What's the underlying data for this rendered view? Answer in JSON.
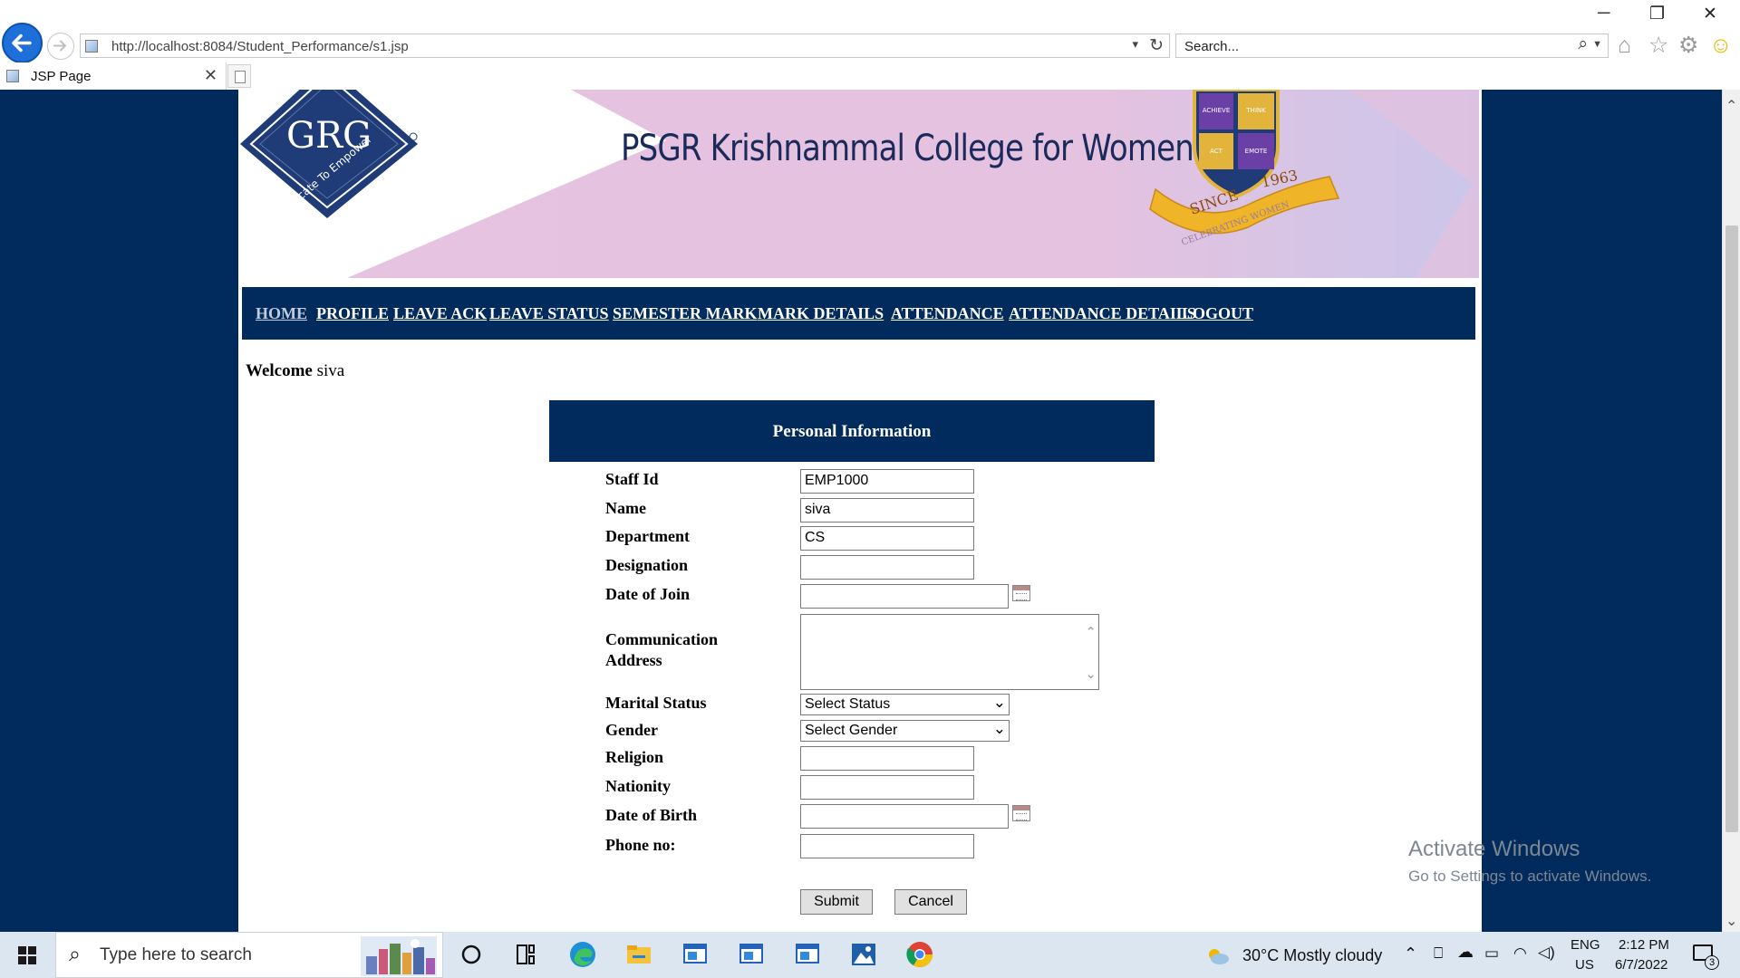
{
  "browser": {
    "url": "http://localhost:8084/Student_Performance/s1.jsp",
    "search_placeholder": "Search...",
    "tab_title": "JSP Page",
    "window_controls": {
      "minimize": "─",
      "restore": "❐",
      "close": "✕"
    }
  },
  "banner": {
    "logo_text": "GRG",
    "logo_tagline": "Educate To Empower",
    "college_name": "PSGR Krishnammal College for Women",
    "crest_words": [
      "ACHIEVE",
      "THINK",
      "ACT",
      "EMOTE"
    ],
    "crest_year": "1963",
    "crest_since": "SINCE",
    "crest_ribbon": "CELEBRATING WOMEN"
  },
  "nav": {
    "items": [
      {
        "label": "HOME",
        "active": true
      },
      {
        "label": "PROFILE"
      },
      {
        "label": "LEAVE ACK"
      },
      {
        "label": "LEAVE STATUS"
      },
      {
        "label": "SEMESTER MARK"
      },
      {
        "label": "MARK DETAILS"
      },
      {
        "label": "ATTENDANCE"
      },
      {
        "label": "ATTENDANCE DETAILS"
      },
      {
        "label": "LOGOUT"
      }
    ]
  },
  "welcome": {
    "prefix": "Welcome",
    "user": "siva"
  },
  "form": {
    "title": "Personal Information",
    "fields": {
      "staff_id": {
        "label": "Staff Id",
        "value": "EMP1000"
      },
      "name": {
        "label": "Name",
        "value": "siva"
      },
      "department": {
        "label": "Department",
        "value": "CS"
      },
      "designation": {
        "label": "Designation",
        "value": ""
      },
      "date_of_join": {
        "label": "Date of Join",
        "value": ""
      },
      "address": {
        "label_line1": "Communication",
        "label_line2": "Address",
        "value": ""
      },
      "marital_status": {
        "label": "Marital Status",
        "selected": "Select Status"
      },
      "gender": {
        "label": "Gender",
        "selected": "Select Gender"
      },
      "religion": {
        "label": "Religion",
        "value": ""
      },
      "nationality": {
        "label": "Nationity",
        "value": ""
      },
      "date_of_birth": {
        "label": "Date of Birth",
        "value": ""
      },
      "phone": {
        "label": "Phone no:",
        "value": ""
      }
    },
    "submit_label": "Submit",
    "cancel_label": "Cancel"
  },
  "watermark": {
    "line1": "Activate Windows",
    "line2": "Go to Settings to activate Windows."
  },
  "taskbar": {
    "search_placeholder": "Type here to search",
    "weather": "30°C  Mostly cloudy",
    "language_line1": "ENG",
    "language_line2": "US",
    "time": "2:12 PM",
    "date": "6/7/2022",
    "notification_count": "3",
    "apps": [
      "cortana-icon",
      "task-view-icon",
      "edge-icon",
      "file-explorer-icon",
      "app-window-icon",
      "app-window-icon",
      "app-window-icon",
      "photos-icon",
      "chrome-icon"
    ]
  },
  "colors": {
    "navy": "#002b5c",
    "banner_pink": "#e5c2df",
    "banner_lavender": "#c9c3e6",
    "taskbar": "#dbe6f1"
  }
}
